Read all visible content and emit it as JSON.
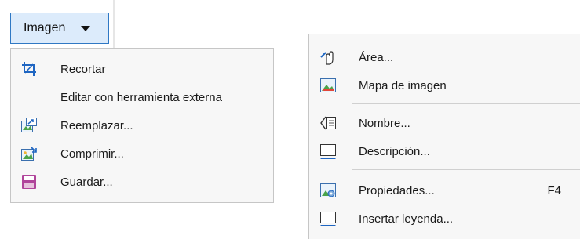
{
  "toolbar": {
    "imagen_label": "Imagen"
  },
  "left_menu": {
    "items": [
      {
        "label": "Recortar",
        "icon": "crop-icon"
      },
      {
        "label": "Editar con herramienta externa",
        "icon": ""
      },
      {
        "label": "Reemplazar...",
        "icon": "replace-image-icon"
      },
      {
        "label": "Comprimir...",
        "icon": "compress-image-icon"
      },
      {
        "label": "Guardar...",
        "icon": "save-icon"
      }
    ]
  },
  "right_menu": {
    "items": [
      {
        "label": "Área...",
        "icon": "area-hand-icon"
      },
      {
        "label": "Mapa de imagen",
        "icon": "image-map-icon"
      },
      {
        "label": "Nombre...",
        "icon": "name-icon"
      },
      {
        "label": "Descripción...",
        "icon": "description-icon"
      },
      {
        "label": "Propiedades...",
        "icon": "properties-icon",
        "shortcut": "F4"
      },
      {
        "label": "Insertar leyenda...",
        "icon": "insert-caption-icon"
      }
    ]
  },
  "colors": {
    "button_border": "#2f78c4",
    "button_fill": "#dcebfb",
    "menu_bg": "#f7f7f7"
  }
}
